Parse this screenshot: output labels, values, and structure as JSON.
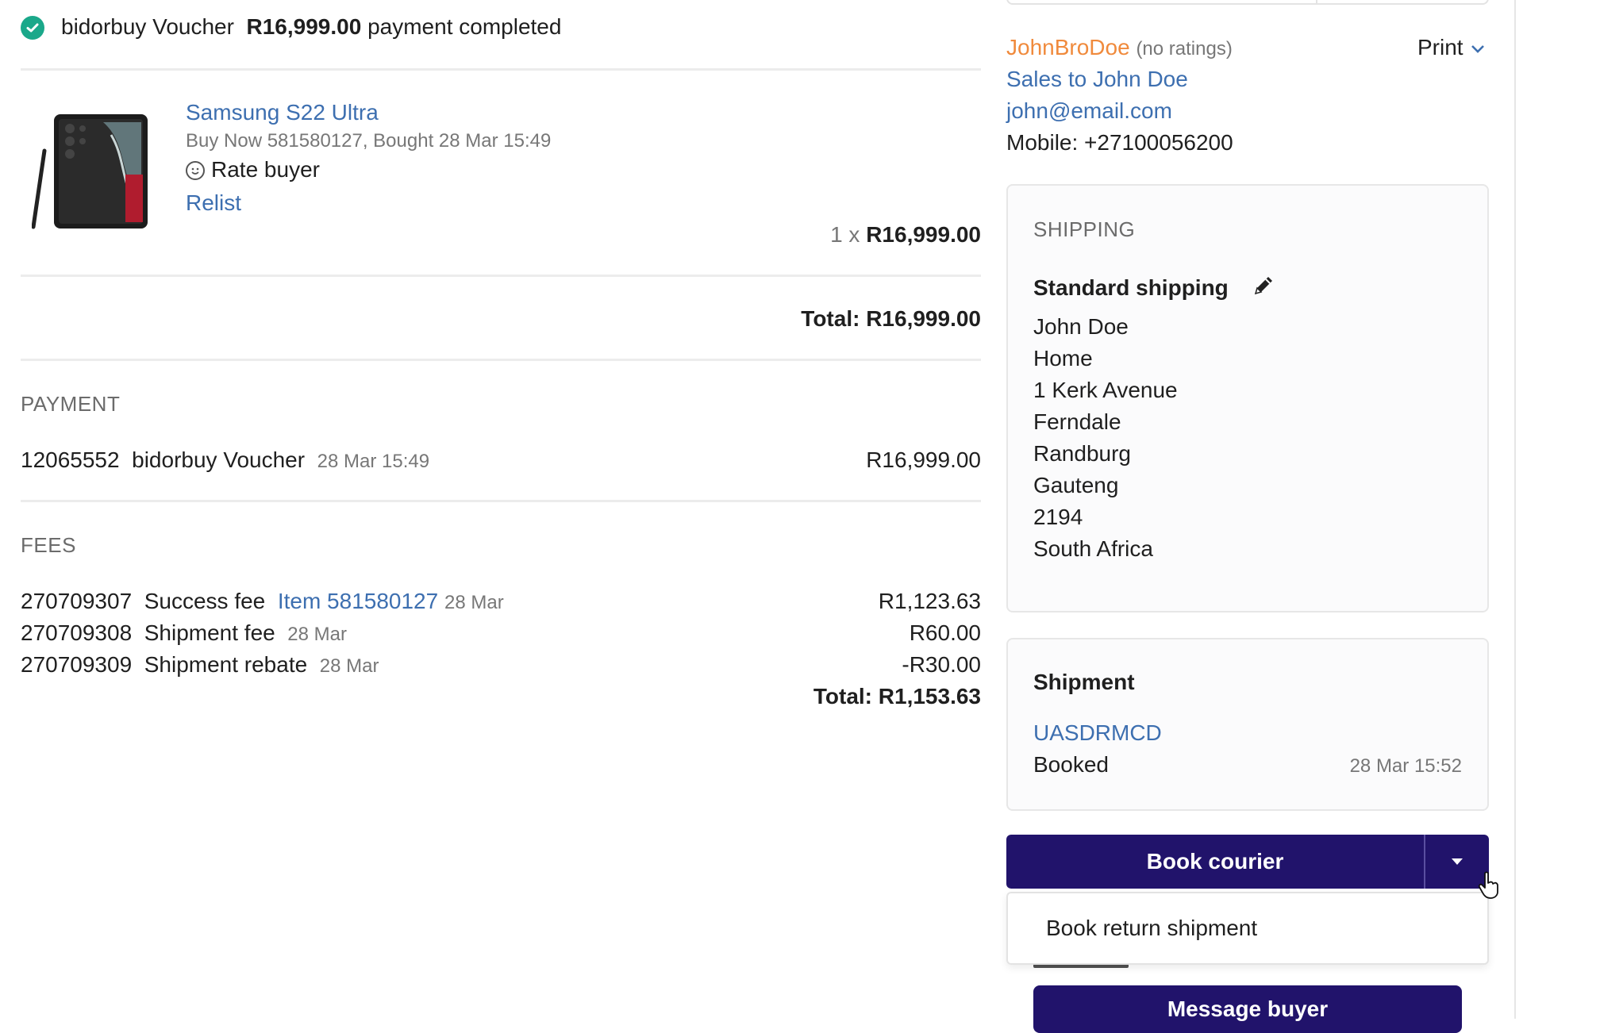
{
  "status": {
    "method": "bidorbuy Voucher",
    "amount": "R16,999.00",
    "text": "payment completed"
  },
  "product": {
    "title": "Samsung S22 Ultra",
    "subtitle": "Buy Now 581580127, Bought 28 Mar 15:49",
    "rate_label": "Rate buyer",
    "relist_label": "Relist",
    "quantity": "1 x",
    "price": "R16,999.00"
  },
  "order_total": "Total: R16,999.00",
  "payment": {
    "heading": "PAYMENT",
    "id": "12065552",
    "method": "bidorbuy Voucher",
    "date": "28 Mar 15:49",
    "amount": "R16,999.00"
  },
  "fees": {
    "heading": "FEES",
    "rows": [
      {
        "id": "270709307",
        "name": "Success fee",
        "link": "Item 581580127",
        "date": "28 Mar",
        "amount": "R1,123.63"
      },
      {
        "id": "270709308",
        "name": "Shipment fee",
        "link": "",
        "date": "28 Mar",
        "amount": "R60.00"
      },
      {
        "id": "270709309",
        "name": "Shipment rebate",
        "link": "",
        "date": "28 Mar",
        "amount": "-R30.00"
      }
    ],
    "total": "Total: R1,153.63"
  },
  "buyer": {
    "username": "JohnBroDoe",
    "ratings": "(no ratings)",
    "print_label": "Print",
    "sales_link": "Sales to John Doe",
    "email": "john@email.com",
    "mobile": "Mobile: +27100056200"
  },
  "shipping": {
    "heading": "SHIPPING",
    "method": "Standard shipping",
    "address": [
      "John Doe",
      "Home",
      "1 Kerk Avenue",
      "Ferndale",
      "Randburg",
      "Gauteng",
      "2194",
      "South Africa"
    ]
  },
  "shipment": {
    "heading": "Shipment",
    "code": "UASDRMCD",
    "status": "Booked",
    "date": "28 Mar 15:52"
  },
  "actions": {
    "book_courier": "Book courier",
    "dropdown_item": "Book return shipment",
    "message_buyer": "Message buyer"
  },
  "colors": {
    "accent": "#21136b",
    "link": "#3d6fb0",
    "username": "#f08a3c",
    "success": "#1aa88a"
  }
}
